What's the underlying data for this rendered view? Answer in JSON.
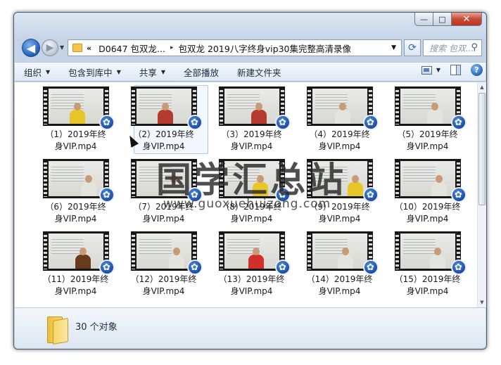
{
  "window": {
    "controls": {
      "minimize": "—",
      "maximize": "□",
      "close": "✕"
    }
  },
  "nav": {
    "back_icon": "back-arrow-icon",
    "forward_icon": "forward-arrow-icon",
    "address": {
      "overflow": "«",
      "crumb1": "D0647 包双龙...",
      "separator": "▸",
      "crumb2": "包双龙 2019八字终身vip30集完整高清录像"
    },
    "search_placeholder": "搜索 包双..."
  },
  "toolbar": {
    "organize": "组织",
    "include_in_library": "包含到库中",
    "share": "共享",
    "play_all": "全部播放",
    "new_folder": "新建文件夹"
  },
  "files": [
    {
      "line1": "（1）2019年终",
      "line2": "身VIP.mp4",
      "shirt": "#e8c629",
      "x": 30
    },
    {
      "line1": "（2）2019年终",
      "line2": "身VIP.mp4",
      "shirt": "#b53a2f",
      "x": 30
    },
    {
      "line1": "（3）2019年终",
      "line2": "身VIP.mp4",
      "shirt": "#b53a2f",
      "x": 38
    },
    {
      "line1": "（4）2019年终",
      "line2": "身VIP.mp4",
      "shirt": "#e4e4df",
      "x": 32
    },
    {
      "line1": "（5）2019年终",
      "line2": "身VIP.mp4",
      "shirt": "#e4e4df",
      "x": 38
    },
    {
      "line1": "（6）2019年终",
      "line2": "身VIP.mp4",
      "shirt": "#e4e4df",
      "x": 46
    },
    {
      "line1": "（7）2019年终",
      "line2": "身VIP.mp4",
      "shirt": "#e4e4df",
      "x": 42
    },
    {
      "line1": "（8）2019年终",
      "line2": "身VIP.mp4",
      "shirt": "#e8c629",
      "x": 40
    },
    {
      "line1": "（9）2019年终",
      "line2": "身VIP.mp4",
      "shirt": "#e8c629",
      "x": 50
    },
    {
      "line1": "（10）2019年终",
      "line2": "身VIP.mp4",
      "shirt": "#e4e4df",
      "x": 44
    },
    {
      "line1": "（11）2019年终",
      "line2": "身VIP.mp4",
      "shirt": "#6a3a1c",
      "x": 38
    },
    {
      "line1": "（12）2019年终",
      "line2": "身VIP.mp4",
      "shirt": "#e4e4df",
      "x": 46
    },
    {
      "line1": "（13）2019年终",
      "line2": "身VIP.mp4",
      "shirt": "#d22f2a",
      "x": 34
    },
    {
      "line1": "（14）2019年终",
      "line2": "身VIP.mp4",
      "shirt": "#e4e4df",
      "x": 36
    },
    {
      "line1": "（15）2019年终",
      "line2": "身VIP.mp4",
      "shirt": "#e4e4df",
      "x": 42
    }
  ],
  "selected_index": 1,
  "status": {
    "count": "30 个对象"
  },
  "watermark": {
    "text": "国学汇总站",
    "url": "www.guoxuehuizong.com"
  }
}
